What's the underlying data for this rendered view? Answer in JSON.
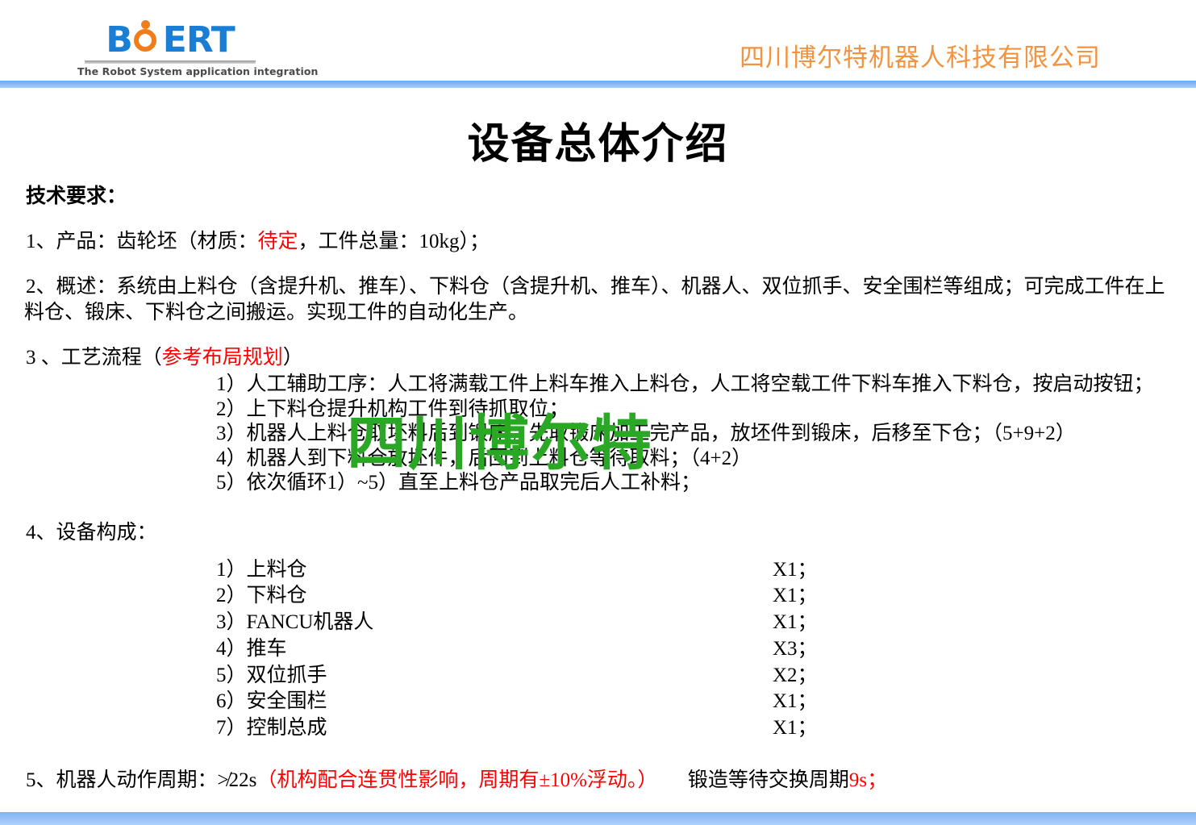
{
  "header": {
    "logo_text": "B",
    "logo_text_2": "ERT",
    "logo_icon": "orange-ring-person-icon",
    "tagline": "The Robot System application integration",
    "company_name": "四川博尔特机器人科技有限公司",
    "company_color": "#f2933f"
  },
  "title": "设备总体介绍",
  "watermark": {
    "text": "四川博尔特",
    "color": "#2aa825"
  },
  "body": {
    "lead": "技术要求：",
    "item1": {
      "before": "1、产品：齿轮坯（材质：",
      "highlight": "待定",
      "after": "，工件总量：10kg）；"
    },
    "item2_line1": "2、概述：系统由上料仓（含提升机、推车）、下料仓（含提升机、推车）、机器人、双位抓手、安全围栏等组成；可完成工件在上",
    "item2_line2": "料仓、锻床、下料仓之间搬运。实现工件的自动化生产。",
    "item3": {
      "before": "3 、工艺流程（",
      "highlight": "参考布局规划",
      "after": "）"
    },
    "flow_steps": [
      "1）人工辅助工序：人工将满载工件上料车推入上料仓，人工将空载工件下料车推入下料仓，按启动按钮；",
      "2）上下料仓提升机构工件到待抓取位；",
      "3）机器人上料仓取坯料后到锻床。先取锻床加工完产品，放坯件到锻床，后移至下仓；（5+9+2）",
      "4）机器人到下料仓放坯件，后回到上料仓等待取料；（4+2）",
      "5）依次循环1）~5）直至上料仓产品取完后人工补料；"
    ],
    "item4": "4、设备构成：",
    "components": [
      {
        "name": "1）上料仓",
        "qty": "X1；"
      },
      {
        "name": "2）下料仓",
        "qty": "X1；"
      },
      {
        "name": "3）FANCU机器人",
        "qty": "X1；"
      },
      {
        "name": "4）推车",
        "qty": "X3；"
      },
      {
        "name": "5）双位抓手",
        "qty": "X2；"
      },
      {
        "name": "6）安全围栏",
        "qty": "X1；"
      },
      {
        "name": "7）控制总成",
        "qty": "X1；"
      }
    ],
    "item5": {
      "before": "5、机器人动作周期：≯22s",
      "highlight": "（机构配合连贯性影响，周期有±10%浮动。）",
      "mid": "　　锻造等待交换周期",
      "highlight2": "9s；"
    }
  }
}
